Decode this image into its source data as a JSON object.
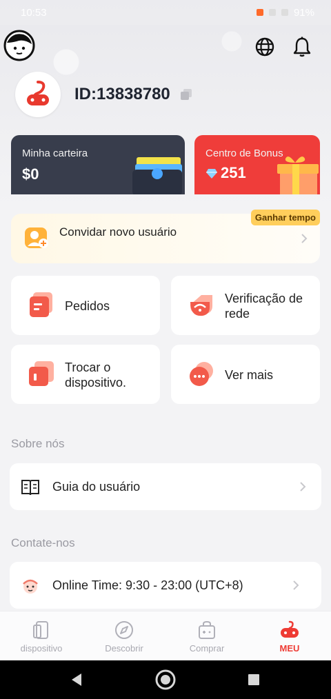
{
  "status": {
    "time": "10:53",
    "battery": "91%"
  },
  "profile": {
    "id_text": "ID:13838780"
  },
  "wallet": {
    "label": "Minha carteira",
    "amount": "$0"
  },
  "bonus": {
    "label": "Centro de Bonus",
    "amount": "251"
  },
  "invite": {
    "label": "Convidar novo usuário",
    "badge": "Ganhar tempo"
  },
  "tiles": [
    {
      "label": "Pedidos"
    },
    {
      "label": "Verificação de rede"
    },
    {
      "label": "Trocar o dispositivo."
    },
    {
      "label": "Ver mais"
    }
  ],
  "about": {
    "title": "Sobre nós",
    "guide": "Guia do usuário"
  },
  "contact": {
    "title": "Contate-nos",
    "online": "Online Time: 9:30 - 23:00 (UTC+8)"
  },
  "tabs": [
    {
      "label": "dispositivo"
    },
    {
      "label": "Descobrir"
    },
    {
      "label": "Comprar"
    },
    {
      "label": "MEU"
    }
  ],
  "colors": {
    "accent": "#ee3b34",
    "wallet_bg": "#383d4c",
    "bonus_bg": "#ef3d3a"
  }
}
